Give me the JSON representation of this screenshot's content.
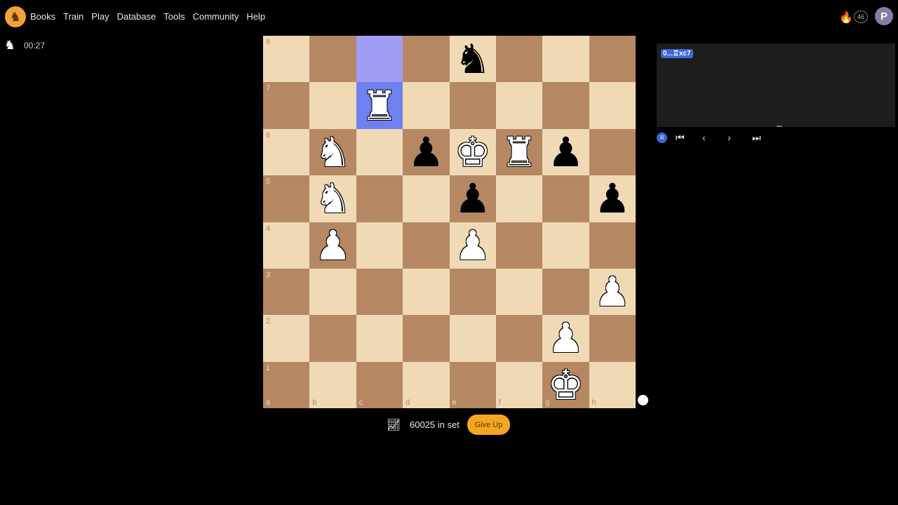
{
  "nav": {
    "logo_label": "CT",
    "items": [
      "Books",
      "Train",
      "Play",
      "Database",
      "Tools",
      "Community",
      "Help"
    ]
  },
  "header": {
    "streak_count": "46",
    "avatar_initial": "P"
  },
  "timer": {
    "value": "00:27"
  },
  "board": {
    "ranks": [
      "8",
      "7",
      "6",
      "5",
      "4",
      "3",
      "2",
      "1"
    ],
    "files": [
      "a",
      "b",
      "c",
      "d",
      "e",
      "f",
      "g",
      "h"
    ],
    "highlight_from": "c8",
    "highlight_to": "c7",
    "pieces": {
      "e8": "bN",
      "c7": "wR",
      "b6": "wN",
      "d6": "bP",
      "e6": "wK",
      "f6": "wR",
      "g6": "bP",
      "b5": "wN",
      "e5": "bP",
      "h5": "bP",
      "b4": "wP",
      "e4": "wP",
      "h3": "wP",
      "g2": "wP",
      "g1": "wK"
    }
  },
  "footer": {
    "set_count": "60025 in set",
    "give_up_label": "Give Up"
  },
  "moves_panel": {
    "current_move": "0...♖xc7"
  },
  "colors": {
    "light_square": "#f0dab5",
    "dark_square": "#b58863",
    "highlight_from": "#a09cf4",
    "highlight_to": "#6f80f0",
    "accent": "#f4a623"
  }
}
